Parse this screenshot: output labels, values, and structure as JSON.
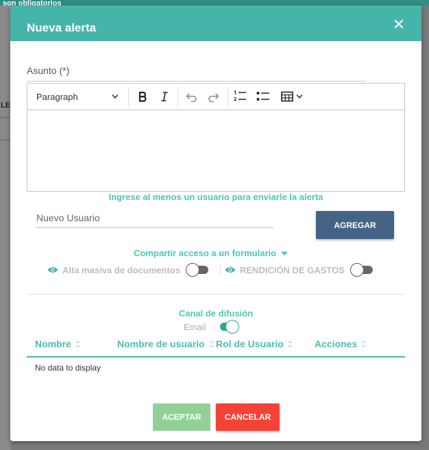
{
  "background": {
    "header_text": "son obligatorios",
    "side_letter": "LE"
  },
  "modal": {
    "title": "Nueva alerta",
    "close_icon": "close-icon"
  },
  "form": {
    "subject_label": "Asunto (*)",
    "editor": {
      "heading_select": "Paragraph",
      "tools": [
        "bold-icon",
        "italic-icon",
        "undo-icon",
        "redo-icon",
        "numbered-list-icon",
        "bulleted-list-icon",
        "table-icon"
      ],
      "content": ""
    },
    "users_hint": "Ingrese al menos un usuario para enviarle la alerta",
    "new_user_placeholder": "Nuevo Usuario",
    "new_user_value": "",
    "add_button": "AGREGAR",
    "share_label": "Compartir acceso a un formulario",
    "permissions": [
      {
        "label": "Alta masiva de documentos",
        "enabled": false
      },
      {
        "label": "RENDICIÓN DE GASTOS",
        "enabled": false
      }
    ],
    "channel_title": "Canal de difusión",
    "channels": [
      {
        "label": "Email",
        "enabled": true
      }
    ]
  },
  "table": {
    "columns": [
      "Nombre",
      "Nombre de usuario",
      "Rol de Usuario",
      "Acciones"
    ],
    "rows": [],
    "empty_text": "No data to display"
  },
  "footer": {
    "accept_button": "ACEPTAR",
    "cancel_button": "CANCELAR"
  },
  "colors": {
    "header": "#45b5aa",
    "accent": "#4ec6bb",
    "add_button": "#456384",
    "accept": "#91d196",
    "cancel": "#f44336"
  }
}
